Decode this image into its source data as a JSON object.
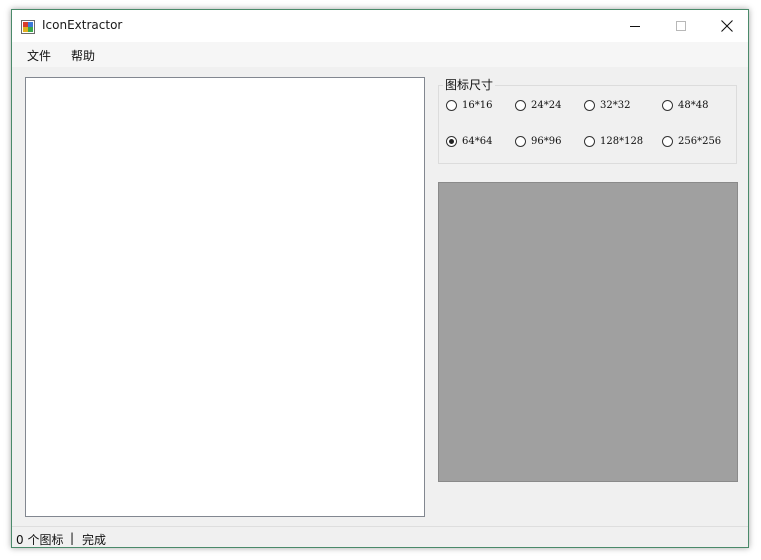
{
  "window": {
    "title": "IconExtractor"
  },
  "menu": {
    "file": "文件",
    "help": "帮助"
  },
  "icon_size_group": {
    "title": "图标尺寸",
    "options": [
      "16*16",
      "24*24",
      "32*32",
      "48*48",
      "64*64",
      "96*96",
      "128*128",
      "256*256"
    ],
    "selected": "64*64"
  },
  "statusbar": {
    "count": "0 个图标",
    "separator": "|",
    "state": "完成"
  },
  "colors": {
    "preview_bg": "#a0a0a0",
    "window_bg": "#f0f0f0"
  },
  "icons": {
    "app": "app-icon",
    "minimize": "minimize-icon",
    "maximize": "maximize-icon",
    "close": "close-icon"
  }
}
